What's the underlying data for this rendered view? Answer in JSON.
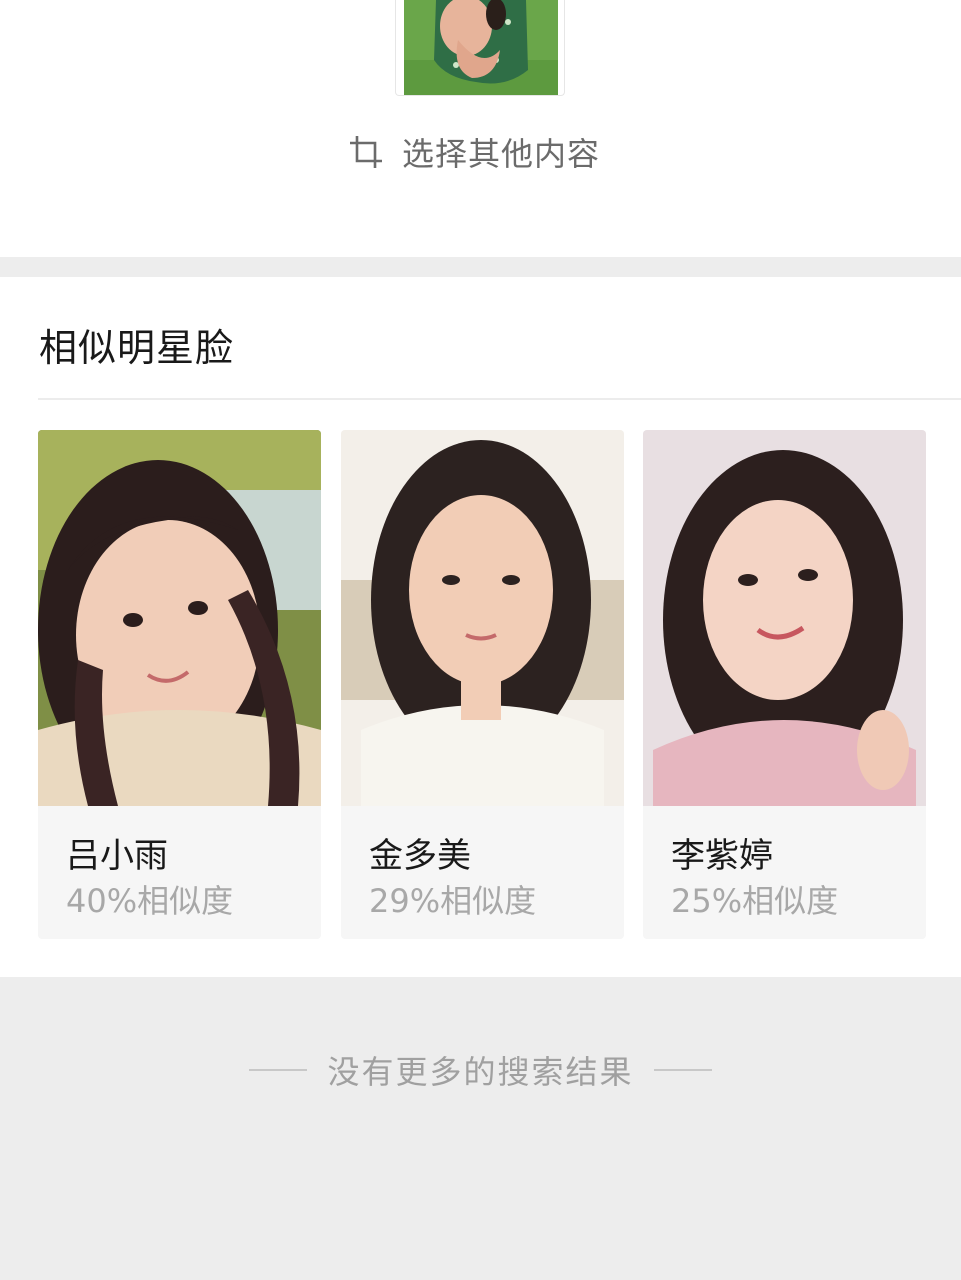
{
  "select_other": {
    "label": "选择其他内容",
    "icon": "crop-icon"
  },
  "section": {
    "title": "相似明星脸"
  },
  "results": [
    {
      "name": "吕小雨",
      "similarity": "40%相似度"
    },
    {
      "name": "金多美",
      "similarity": "29%相似度"
    },
    {
      "name": "李紫婷",
      "similarity": "25%相似度"
    }
  ],
  "footer": {
    "no_more": "没有更多的搜索结果"
  },
  "colors": {
    "background": "#ededed",
    "card": "#f6f6f6",
    "muted_text": "#a8a8a8"
  }
}
